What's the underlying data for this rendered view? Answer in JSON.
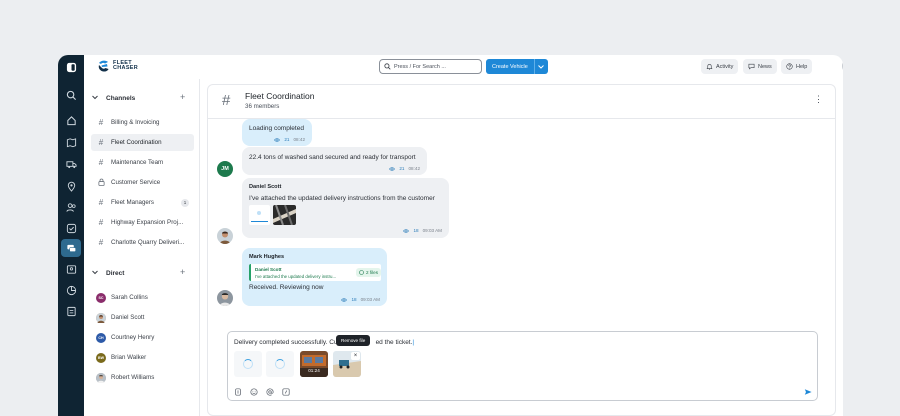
{
  "brand": {
    "line1": "FLEET",
    "line2": "CHASER"
  },
  "topbar": {
    "search_placeholder": "Press / For Search ...",
    "create_vehicle": "Create Vehicle",
    "activity": "Activity",
    "news": "News",
    "help": "Help"
  },
  "sidebar": {
    "channels_title": "Channels",
    "channels": [
      {
        "label": "Billing & Invoicing",
        "icon": "hash-icon"
      },
      {
        "label": "Fleet Coordination",
        "icon": "hash-icon",
        "selected": true
      },
      {
        "label": "Maintenance Team",
        "icon": "hash-icon"
      },
      {
        "label": "Customer Service",
        "icon": "lock-icon"
      },
      {
        "label": "Fleet Managers",
        "icon": "hash-icon",
        "badge": "1"
      },
      {
        "label": "Highway Expansion Proj...",
        "icon": "hash-icon"
      },
      {
        "label": "Charlotte Quarry Deliveri...",
        "icon": "hash-icon"
      }
    ],
    "direct_title": "Direct",
    "direct": [
      {
        "label": "Sarah Collins",
        "initials": "SC"
      },
      {
        "label": "Daniel Scott",
        "initials": ""
      },
      {
        "label": "Courtney Henry",
        "initials": "CH"
      },
      {
        "label": "Brian Walker",
        "initials": "BW"
      },
      {
        "label": "Robert Williams",
        "initials": ""
      }
    ]
  },
  "channel": {
    "title": "Fleet Coordination",
    "members": "36 members"
  },
  "messages": [
    {
      "text": "Loading completed",
      "views": "21",
      "time": "08:42"
    },
    {
      "avatar": "JM",
      "text": "22.4 tons of washed sand secured and ready for transport",
      "views": "21",
      "time": "08:42"
    },
    {
      "name": "Daniel Scott",
      "text": "I've attached the updated delivery instructions from the customer",
      "views": "18",
      "time": "09:03 AM"
    },
    {
      "name": "Mark Hughes",
      "quote_name": "Daniel Scott",
      "quote_text": "I've attached the updated delivery instru...",
      "quote_files": "2 files",
      "text": "Received. Reviewing now",
      "views": "18",
      "time": "09:03 AM"
    }
  ],
  "composer": {
    "text": "Delivery completed successfully. Cu",
    "text_end": "ed the ticket.",
    "tooltip": "Remove file",
    "video_duration": "01:24"
  },
  "colors": {
    "accent": "#1e88d7",
    "rail": "#0f2433",
    "mine_bubble": "#d9eefb"
  }
}
